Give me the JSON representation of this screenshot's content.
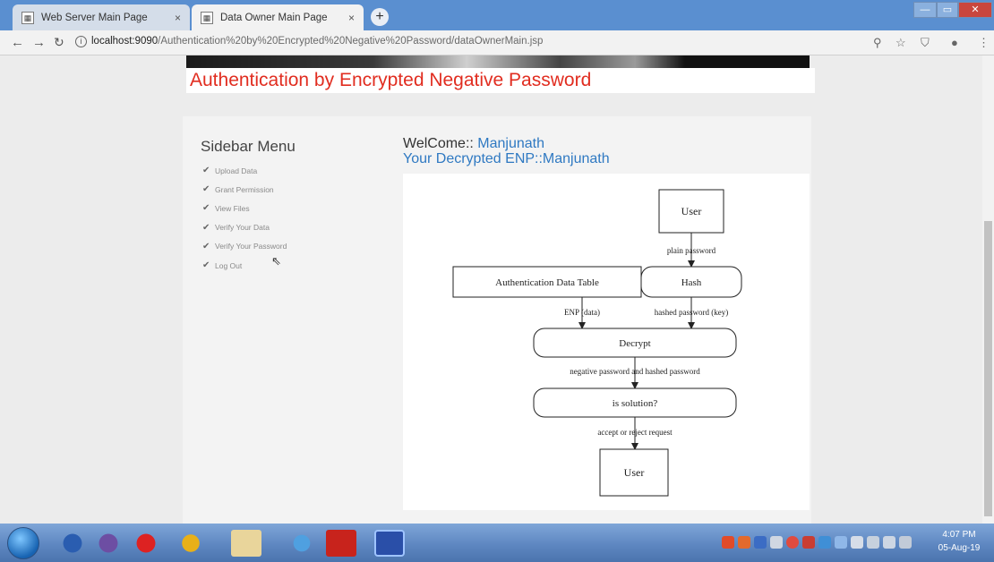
{
  "browser": {
    "tabs": [
      {
        "title": "Web Server Main Page",
        "close": "×"
      },
      {
        "title": "Data Owner Main Page",
        "close": "×"
      }
    ],
    "new_tab": "+",
    "window_controls": {
      "min": "—",
      "max": "▭",
      "close": "✕"
    },
    "address": {
      "host": "localhost:9090",
      "path": "/Authentication%20by%20Encrypted%20Negative%20Password/dataOwnerMain.jsp"
    }
  },
  "page": {
    "banner_title": "Authentication by Encrypted Negative Password",
    "sidebar": {
      "title": "Sidebar Menu",
      "items": [
        {
          "label": "Upload Data"
        },
        {
          "label": "Grant Permission"
        },
        {
          "label": "View Files"
        },
        {
          "label": "Verify Your Data"
        },
        {
          "label": "Verify Your Password"
        },
        {
          "label": "Log Out"
        }
      ]
    },
    "welcome_prefix": "WelCome::",
    "welcome_name": "Manjunath",
    "decrypted_line": "Your Decrypted ENP::Manjunath"
  },
  "diagram": {
    "user_top": "User",
    "plain_password": "plain password",
    "auth_table": "Authentication Data Table",
    "hash": "Hash",
    "enp_data": "ENP (data)",
    "hashed_key": "hashed password (key)",
    "decrypt": "Decrypt",
    "neg_and_hashed": "negative password and hashed password",
    "is_solution": "is solution?",
    "accept_reject": "accept or reject request",
    "user_bottom": "User"
  },
  "taskbar": {
    "time": "4:07 PM",
    "date": "05-Aug-19"
  },
  "colors": {
    "title_red": "#e12d20",
    "link_blue": "#2f79c2"
  }
}
